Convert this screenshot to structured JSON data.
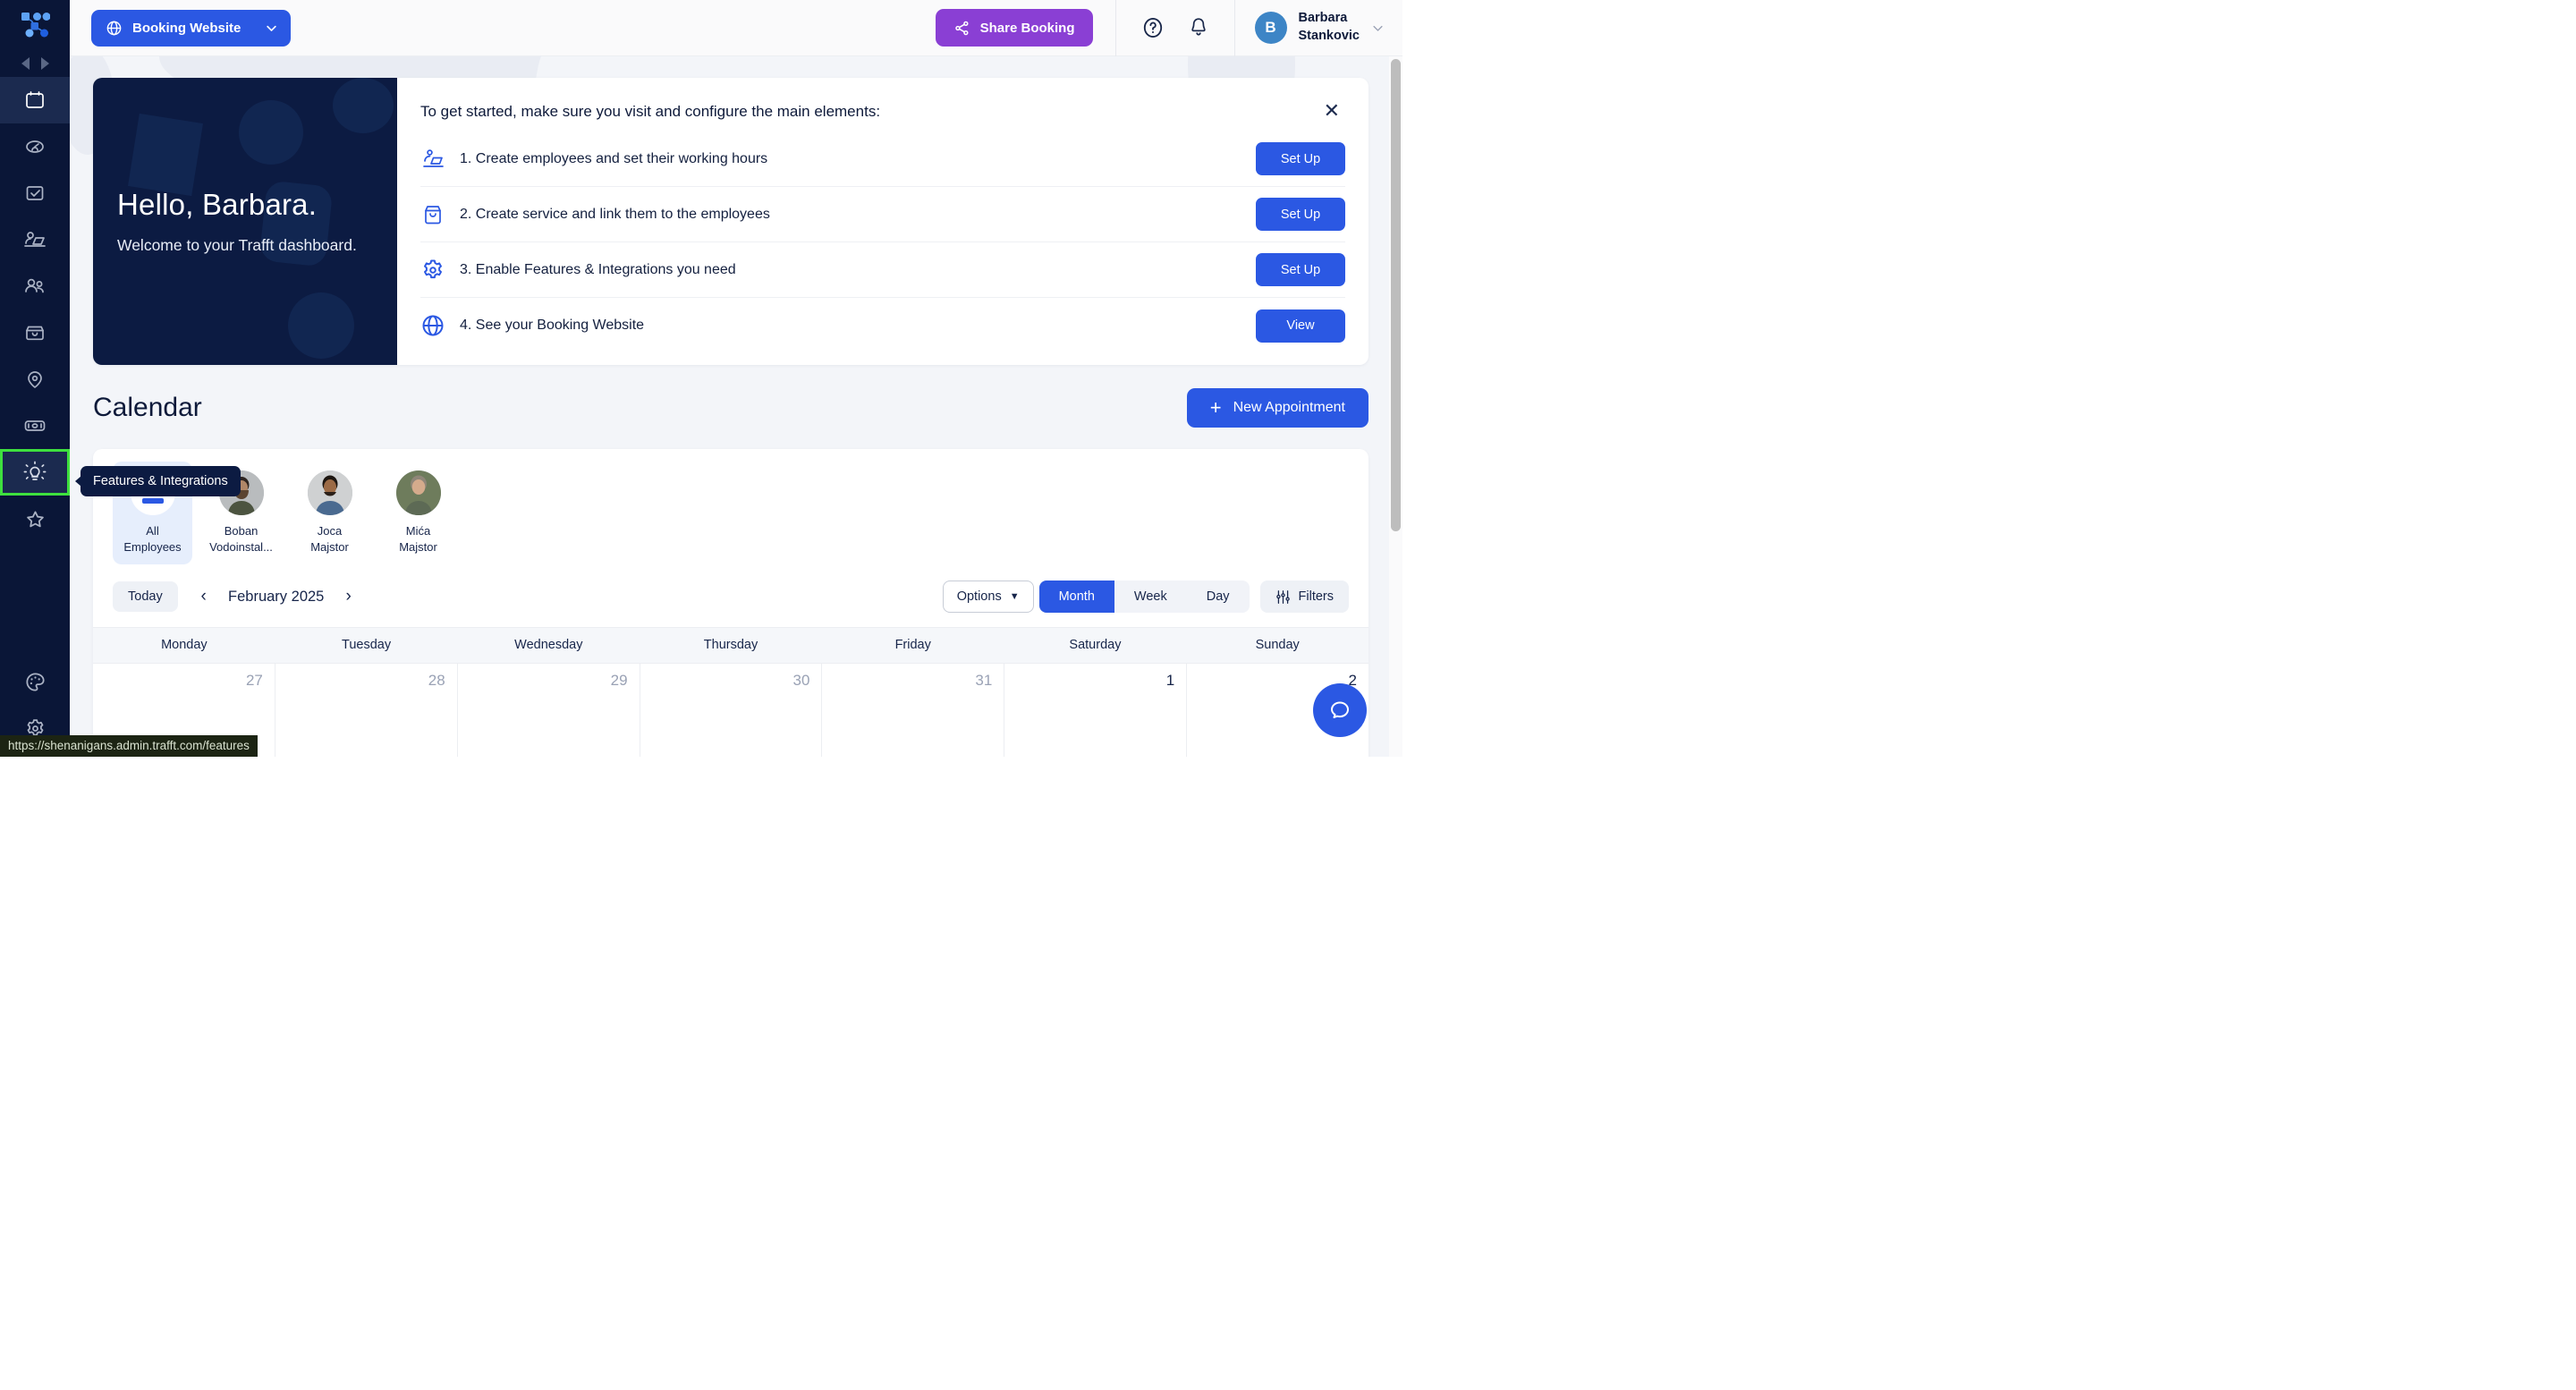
{
  "sidebar": {
    "logo_name": "trafft-logo",
    "collapse_left_icon": "caret-left-icon",
    "collapse_right_icon": "caret-right-icon",
    "items": [
      {
        "name": "calendar",
        "icon": "calendar-icon",
        "active": true,
        "highlight": false
      },
      {
        "name": "dashboard",
        "icon": "gauge-icon",
        "active": false,
        "highlight": false
      },
      {
        "name": "appointments",
        "icon": "task-check-icon",
        "active": false,
        "highlight": false
      },
      {
        "name": "employees",
        "icon": "employee-icon",
        "active": false,
        "highlight": false
      },
      {
        "name": "customers",
        "icon": "users-icon",
        "active": false,
        "highlight": false
      },
      {
        "name": "services",
        "icon": "box-icon",
        "active": false,
        "highlight": false
      },
      {
        "name": "locations",
        "icon": "pin-icon",
        "active": false,
        "highlight": false
      },
      {
        "name": "finance",
        "icon": "money-icon",
        "active": false,
        "highlight": false
      },
      {
        "name": "features-integrations",
        "icon": "bulb-icon",
        "active": false,
        "highlight": true
      },
      {
        "name": "reviews",
        "icon": "star-icon",
        "active": false,
        "highlight": false
      }
    ],
    "bottom_items": [
      {
        "name": "customize",
        "icon": "palette-icon"
      },
      {
        "name": "settings",
        "icon": "gear-icon"
      }
    ],
    "tooltip_label": "Features & Integrations"
  },
  "topbar": {
    "booking_website_label": "Booking Website",
    "booking_website_icon": "globe-icon",
    "booking_website_chevron": "chevron-down-icon",
    "share_booking_label": "Share Booking",
    "share_booking_icon": "share-icon",
    "help_icon": "question-circle-icon",
    "notifications_icon": "bell-icon",
    "user_initial": "B",
    "user_name_line1": "Barbara",
    "user_name_line2": "Stankovic",
    "user_chevron": "chevron-down-icon"
  },
  "hello_card": {
    "title": "Hello, Barbara.",
    "subtitle": "Welcome to your Trafft dashboard."
  },
  "checklist": {
    "heading": "To get started, make sure you visit and configure the main elements:",
    "close_icon": "close-icon",
    "items": [
      {
        "icon": "employee-desk-icon",
        "label": "1. Create employees and set their working hours",
        "button": "Set Up"
      },
      {
        "icon": "service-box-icon",
        "label": "2. Create service and link them to the employees",
        "button": "Set Up"
      },
      {
        "icon": "gear-icon",
        "label": "3. Enable Features & Integrations you need",
        "button": "Set Up"
      },
      {
        "icon": "globe-icon",
        "label": "4. See your Booking Website",
        "button": "View"
      }
    ]
  },
  "calendar": {
    "title": "Calendar",
    "new_appointment_label": "New Appointment",
    "new_appointment_icon": "plus-icon",
    "employees": [
      {
        "name": "All\nEmployees",
        "line1": "All",
        "line2": "Employees",
        "selected": true,
        "avatar": "all-employees-avatar"
      },
      {
        "name": "Boban Vodoinstal…",
        "line1": "Boban",
        "line2": "Vodoinstal...",
        "selected": false,
        "avatar": "employee-photo"
      },
      {
        "name": "Joca Majstor",
        "line1": "Joca",
        "line2": "Majstor",
        "selected": false,
        "avatar": "employee-photo"
      },
      {
        "name": "Mića Majstor",
        "line1": "Mića",
        "line2": "Majstor",
        "selected": false,
        "avatar": "employee-photo"
      }
    ],
    "today_label": "Today",
    "prev_icon": "chevron-left-icon",
    "next_icon": "chevron-right-icon",
    "month_label": "February 2025",
    "options_label": "Options",
    "options_chevron": "chevron-down-icon",
    "views": [
      {
        "label": "Month",
        "active": true
      },
      {
        "label": "Week",
        "active": false
      },
      {
        "label": "Day",
        "active": false
      }
    ],
    "filters_label": "Filters",
    "filters_icon": "sliders-icon",
    "day_headers": [
      "Monday",
      "Tuesday",
      "Wednesday",
      "Thursday",
      "Friday",
      "Saturday",
      "Sunday"
    ],
    "first_week": [
      {
        "num": "27",
        "muted": true
      },
      {
        "num": "28",
        "muted": true
      },
      {
        "num": "29",
        "muted": true
      },
      {
        "num": "30",
        "muted": true
      },
      {
        "num": "31",
        "muted": true
      },
      {
        "num": "1",
        "muted": false
      },
      {
        "num": "2",
        "muted": false
      }
    ]
  },
  "help_bubble": {
    "icon": "chat-bubble-icon"
  },
  "status_bar": {
    "url": "https://shenanigans.admin.trafft.com/features"
  },
  "colors": {
    "sidebar_bg": "#0a1637",
    "primary_blue": "#2b58e3",
    "share_purple": "#8a3fd4",
    "hello_card_bg": "#0c1b42",
    "content_bg": "#f3f5f9",
    "highlight_green": "#3ee03e",
    "avatar_blue": "#3d85c6",
    "text_navy": "#17254a",
    "muted_gray": "#9aa2b5"
  }
}
